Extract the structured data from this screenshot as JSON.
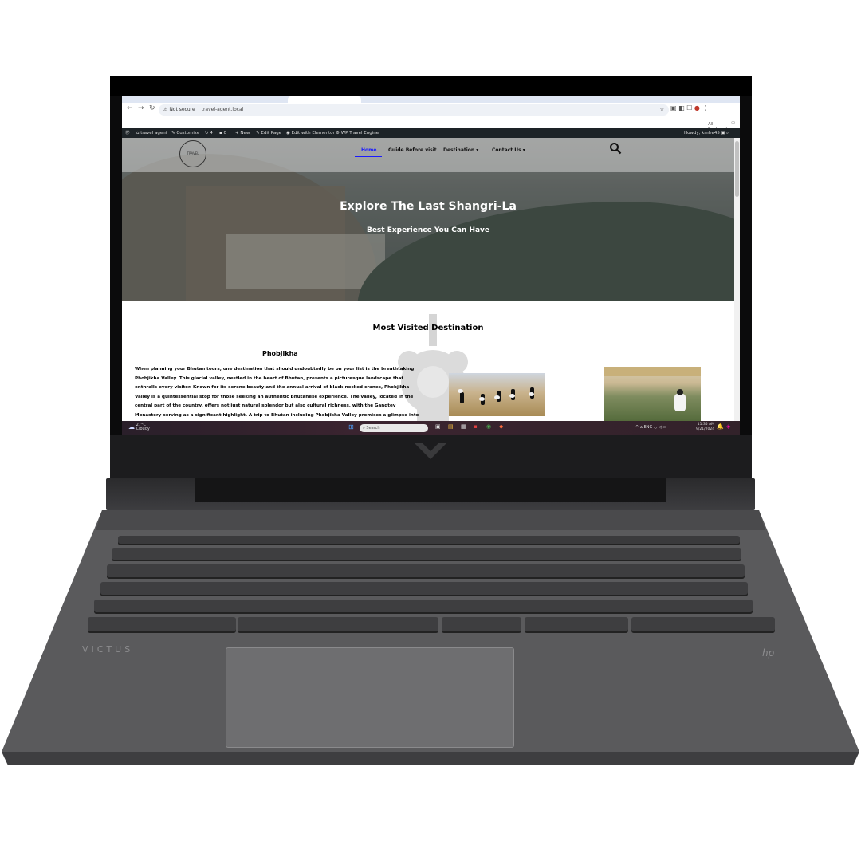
{
  "browser": {
    "security_label": "Not secure",
    "url": "travel-agent.local",
    "bookmarks_label": "All Bookmarks"
  },
  "wp_admin_bar": {
    "site_name": "travel agent",
    "customize": "Customize",
    "updates_count": "4",
    "comments_count": "0",
    "new_label": "New",
    "edit_page": "Edit Page",
    "elementor": "Edit with Elementor",
    "travel_engine": "WP Travel Engine",
    "howdy": "Howdy, kmlre45"
  },
  "site": {
    "logo_text": "TRAVEL",
    "menu": {
      "home": "Home",
      "guide": "Guide Before visit",
      "destination": "Destination",
      "contact": "Contact Us"
    },
    "hero": {
      "title": "Explore The Last Shangri-La",
      "subtitle": "Best Experience You Can Have"
    },
    "section_title": "Most Visited Destination",
    "destination": {
      "name": "Phobjikha",
      "description": "When planning your Bhutan tours, one destination that should undoubtedly be on your list is the breathtaking Phobjikha Valley. This glacial valley, nestled in the heart of Bhutan, presents a picturesque landscape that enthralls every visitor. Known for its serene beauty and the annual arrival of black-necked cranes, Phobjikha Valley is a quintessential stop for those seeking an authentic Bhutanese experience. The valley, located in the central part of the country, offers not just natural splendor but also cultural richness, with the Gangtey Monastery serving as a significant highlight. A trip to Bhutan including Phobjikha Valley promises a glimpse into"
    }
  },
  "taskbar": {
    "temperature": "27°C",
    "weather": "Cloudy",
    "search_placeholder": "Search",
    "lang": "ENG",
    "time": "11:35 AM",
    "date": "9/21/2024"
  },
  "laptop": {
    "brand": "VICTUS",
    "logo": "hp"
  }
}
